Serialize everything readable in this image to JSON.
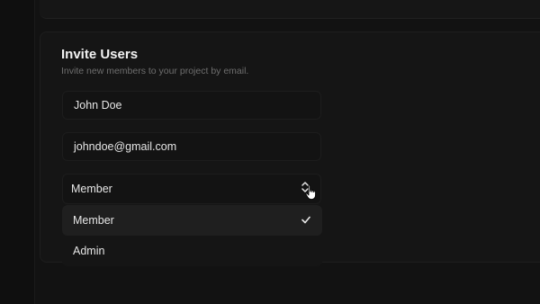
{
  "invite": {
    "title": "Invite Users",
    "subtitle": "Invite new members to your project by email.",
    "name_value": "John Doe",
    "email_value": "johndoe@gmail.com",
    "role_selected": "Member"
  },
  "role_dropdown": {
    "options": [
      {
        "label": "Member",
        "selected": true
      },
      {
        "label": "Admin",
        "selected": false
      }
    ]
  },
  "icons": {
    "role_chevron": "chevron-up-down-icon",
    "selected_mark": "check-icon",
    "pointer": "hand-cursor-icon"
  },
  "colors": {
    "background": "#121212",
    "card": "#151515",
    "highlight": "#1f1f1f",
    "text": "#e6e6e6",
    "muted": "#6e6e6e"
  }
}
